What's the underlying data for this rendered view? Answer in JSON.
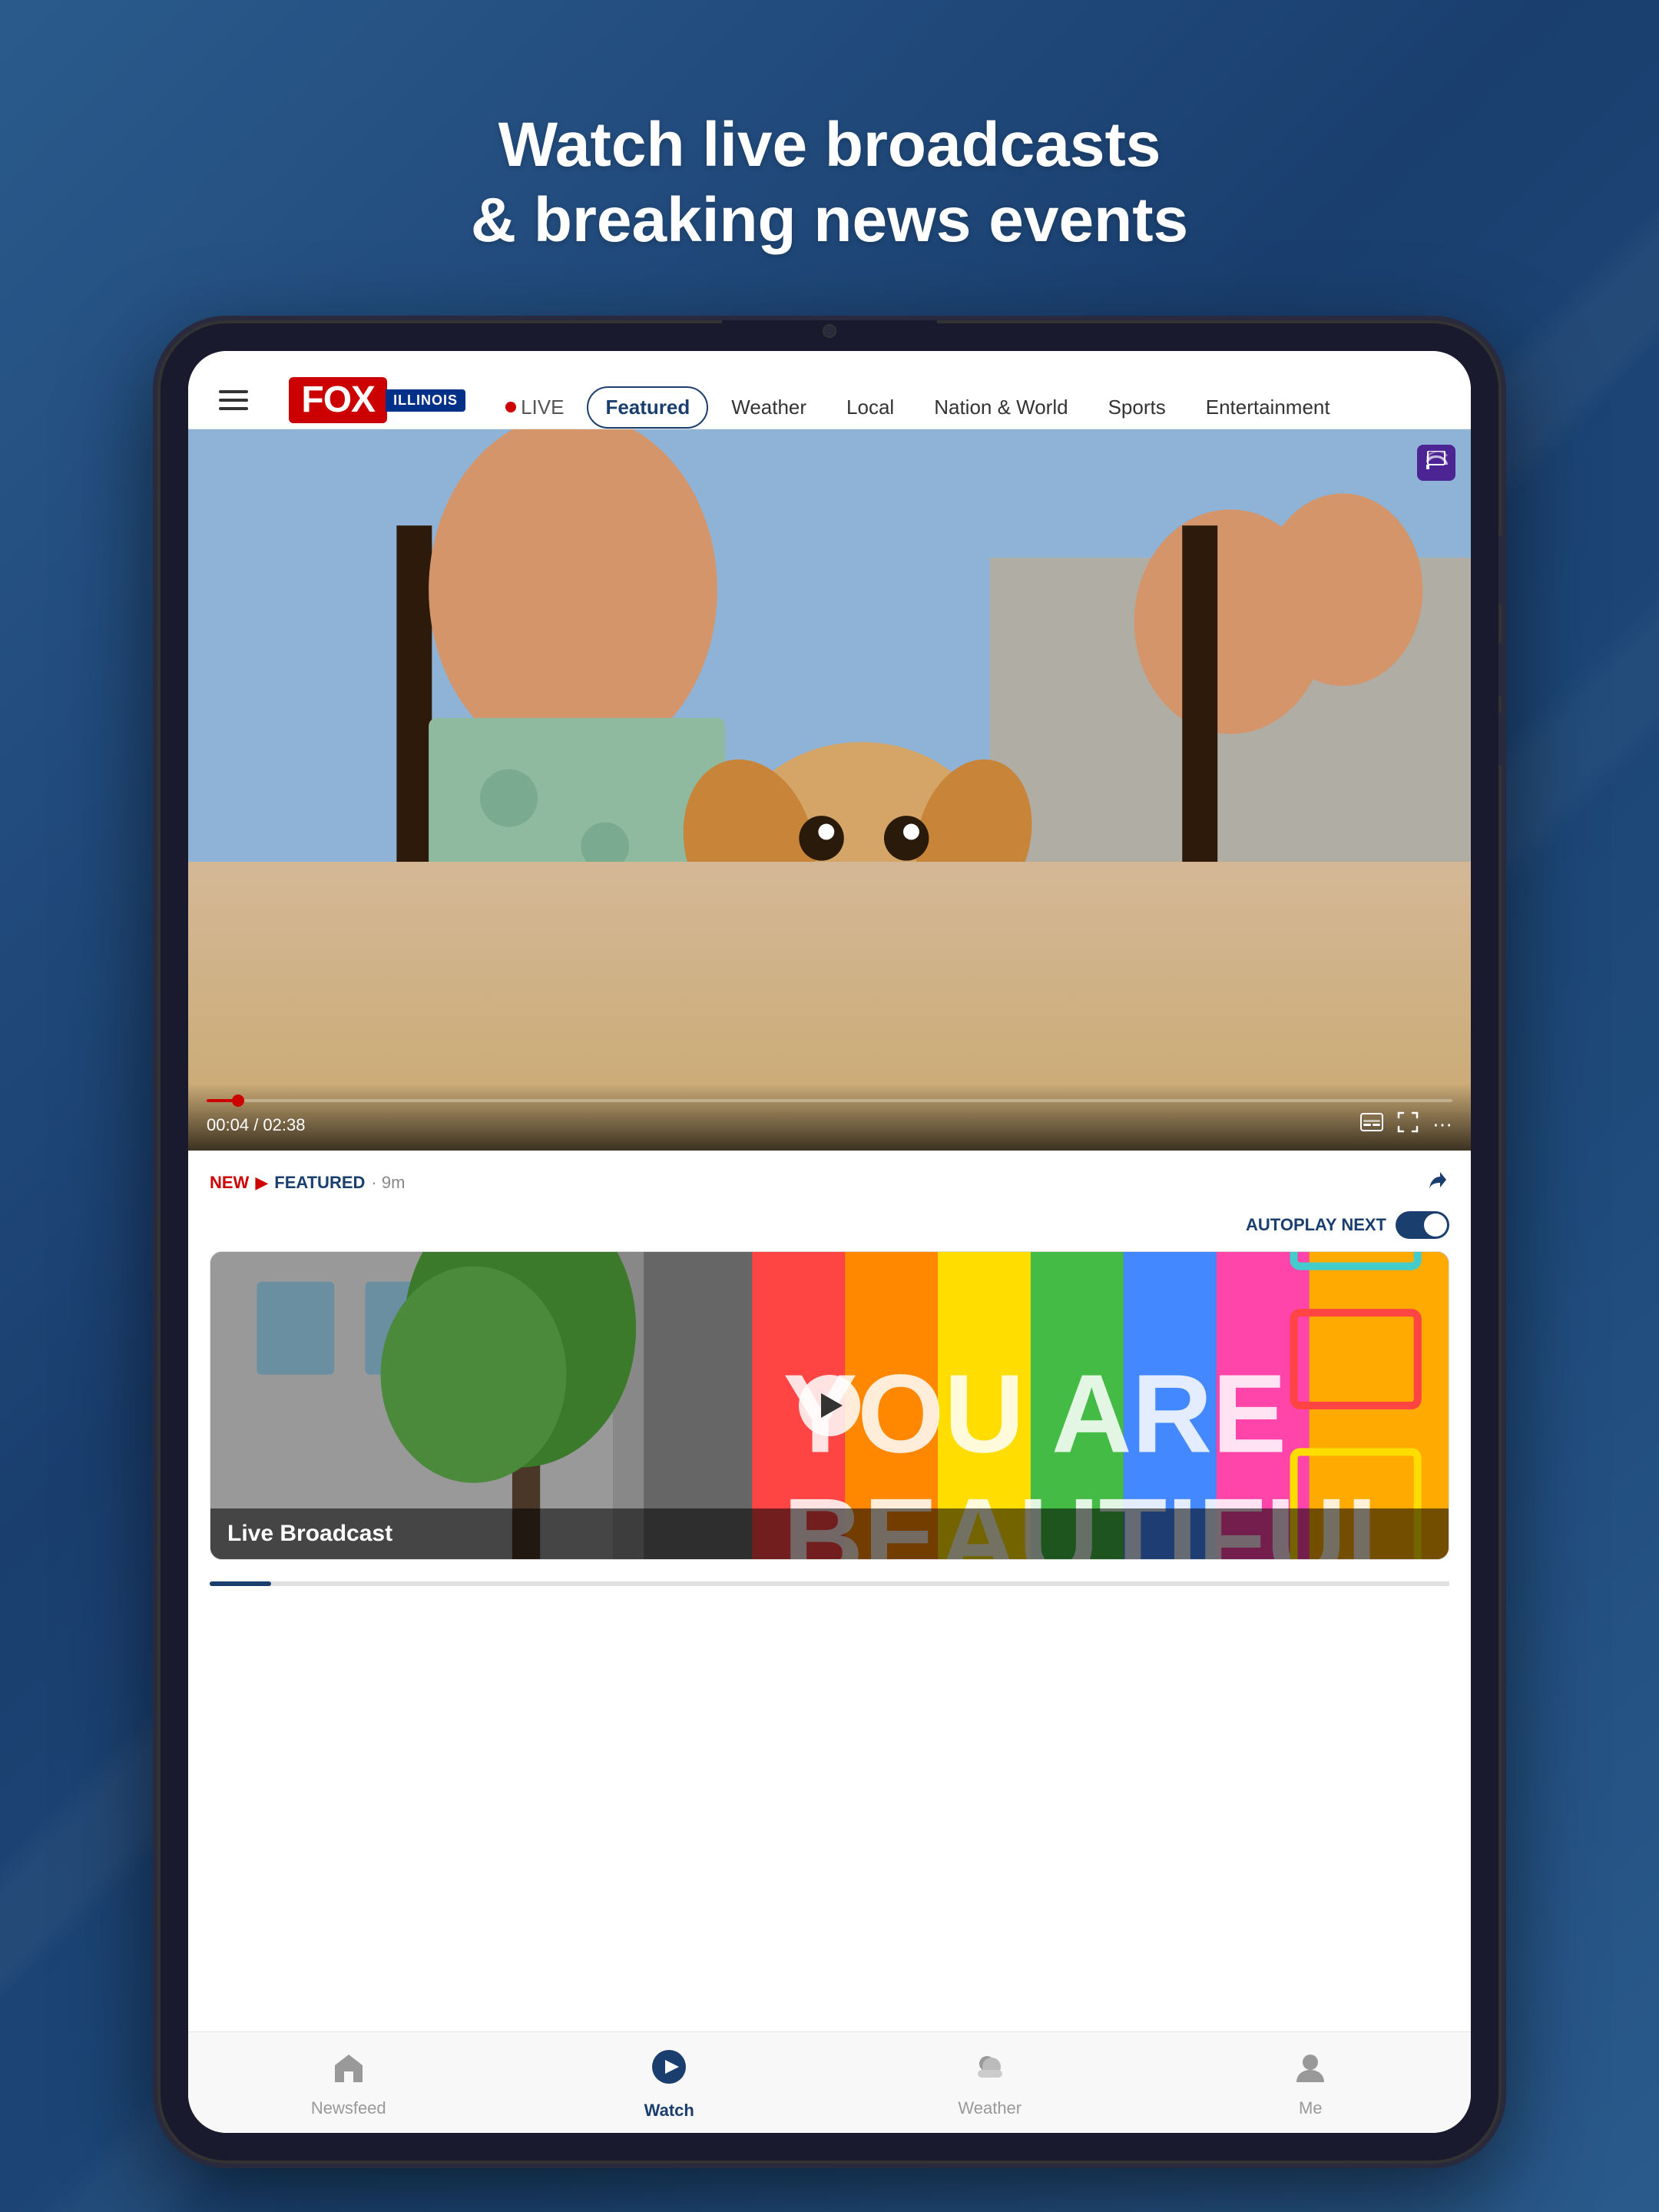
{
  "page": {
    "headline_line1": "Watch live broadcasts",
    "headline_line2": "& breaking news events"
  },
  "header": {
    "logo_fox": "FOX",
    "logo_illinois": "ILLINOIS",
    "hamburger_label": "Menu"
  },
  "nav": {
    "tabs": [
      {
        "id": "live",
        "label": "LIVE",
        "type": "live"
      },
      {
        "id": "featured",
        "label": "Featured",
        "active": true
      },
      {
        "id": "weather",
        "label": "Weather"
      },
      {
        "id": "local",
        "label": "Local"
      },
      {
        "id": "nation",
        "label": "Nation & World"
      },
      {
        "id": "sports",
        "label": "Sports"
      },
      {
        "id": "entertainment",
        "label": "Entertainment"
      }
    ]
  },
  "video": {
    "time_current": "00:04",
    "time_total": "02:38",
    "cast_icon": "📺"
  },
  "article": {
    "tag_new": "NEW",
    "tag_arrow": "▶",
    "tag_featured": "FEATURED",
    "tag_time": "9m",
    "autoplay_label": "AUTOPLAY NEXT"
  },
  "video_card": {
    "title": "Live Broadcast"
  },
  "bottom_nav": {
    "items": [
      {
        "id": "newsfeed",
        "label": "Newsfeed",
        "icon": "🏠",
        "active": false
      },
      {
        "id": "watch",
        "label": "Watch",
        "icon": "▶",
        "active": true
      },
      {
        "id": "weather",
        "label": "Weather",
        "icon": "⛅",
        "active": false
      },
      {
        "id": "me",
        "label": "Me",
        "icon": "👤",
        "active": false
      }
    ]
  },
  "colors": {
    "brand_blue": "#1a3f6f",
    "brand_red": "#cc0000",
    "active_tab_border": "#1a3f6f"
  }
}
